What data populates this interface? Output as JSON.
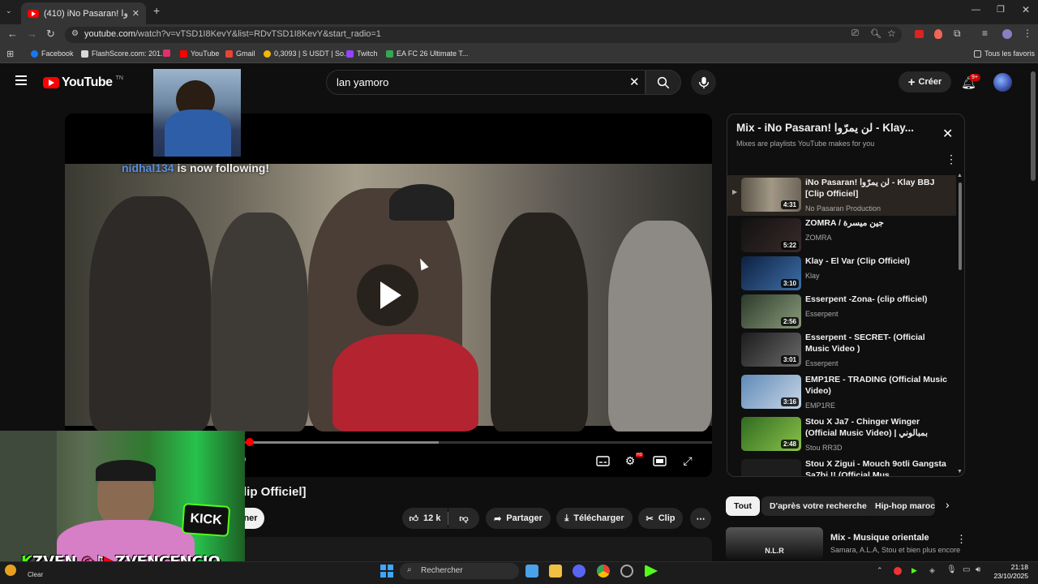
{
  "browser": {
    "tab_title": "(410) iNo Pasaran! لن يمرّوا ·",
    "url_host": "youtube.com",
    "url_path": "/watch?v=vTSD1I8KevY&list=RDvTSD1I8KevY&start_radio=1",
    "bookmarks": [
      {
        "label": "Facebook",
        "color": "#1877f2"
      },
      {
        "label": "FlashScore.com: 201...",
        "color": "#d9d9d9"
      },
      {
        "label": "",
        "color": "#e1306c"
      },
      {
        "label": "YouTube",
        "color": "#ff0000"
      },
      {
        "label": "Gmail",
        "color": "#ea4335"
      },
      {
        "label": "0,3093 | S USDT | So...",
        "color": "#f0b90b"
      },
      {
        "label": "Twitch",
        "color": "#9146ff"
      },
      {
        "label": "EA FC 26 Ultimate T...",
        "color": "#34a853"
      }
    ],
    "all_bookmarks": "Tous les favoris"
  },
  "youtube": {
    "logo_text": "YouTube",
    "country": "TN",
    "search_value": "lan yamoro",
    "create_label": "Créer",
    "notif_count": "9+"
  },
  "player": {
    "follow_user": "nidhal134",
    "follow_text": " is now following!",
    "progress_played": 0.286,
    "progress_loaded": 0.578,
    "time_fragment": "0",
    "title_fragment": "lip Officiel]",
    "subscribe_fragment": "ner"
  },
  "actions": {
    "likes": "12 k",
    "share": "Partager",
    "download": "Télécharger",
    "clip": "Clip"
  },
  "playlist": {
    "title": "Mix - iNo Pasaran! لن يمرّوا - Klay...",
    "subtitle": "Mixes are playlists YouTube makes for you",
    "items": [
      {
        "title": "iNo Pasaran! لن يمرّوا - Klay BBJ [Clip Officiel]",
        "channel": "No Pasaran Production",
        "duration": "4:31",
        "current": true
      },
      {
        "title": "ZOMRA / جين ميسرة",
        "channel": "ZOMRA",
        "duration": "5:22"
      },
      {
        "title": "Klay - El Var (Clip Officiel)",
        "channel": "Klay",
        "duration": "3:10"
      },
      {
        "title": "Esserpent -Zona- (clip officiel)",
        "channel": "Esserpent",
        "duration": "2:56"
      },
      {
        "title": "Esserpent - SECRET- (Official Music Video )",
        "channel": "Esserpent",
        "duration": "3:01"
      },
      {
        "title": "EMP1RE - TRADING (Official Music Video)",
        "channel": "EMP1RE",
        "duration": "3:16"
      },
      {
        "title": "Stou X Ja7 - Chinger Winger (Official Music Video) | بمبالوني",
        "channel": "Stou RR3D",
        "duration": "2:48"
      },
      {
        "title": "Stou X Zigui - Mouch 9otli Gangsta Sa7bi !! (Official Mus...",
        "channel": "",
        "duration": ""
      }
    ]
  },
  "chips": [
    "Tout",
    "D'après votre recherche",
    "Hip-hop maroc"
  ],
  "recommendation": {
    "thumb_text": "N.L.R",
    "title": "Mix - Musique orientale",
    "subtitle": "Samara, A.L.A, Stou et bien plus encore"
  },
  "stream": {
    "name": "ZVENCENCIO",
    "kick_label": "KICK",
    "left_label": "ZVEN",
    "clear": "Clear"
  },
  "taskbar": {
    "search": "Rechercher",
    "time": "21:18",
    "date": "23/10/2025"
  }
}
